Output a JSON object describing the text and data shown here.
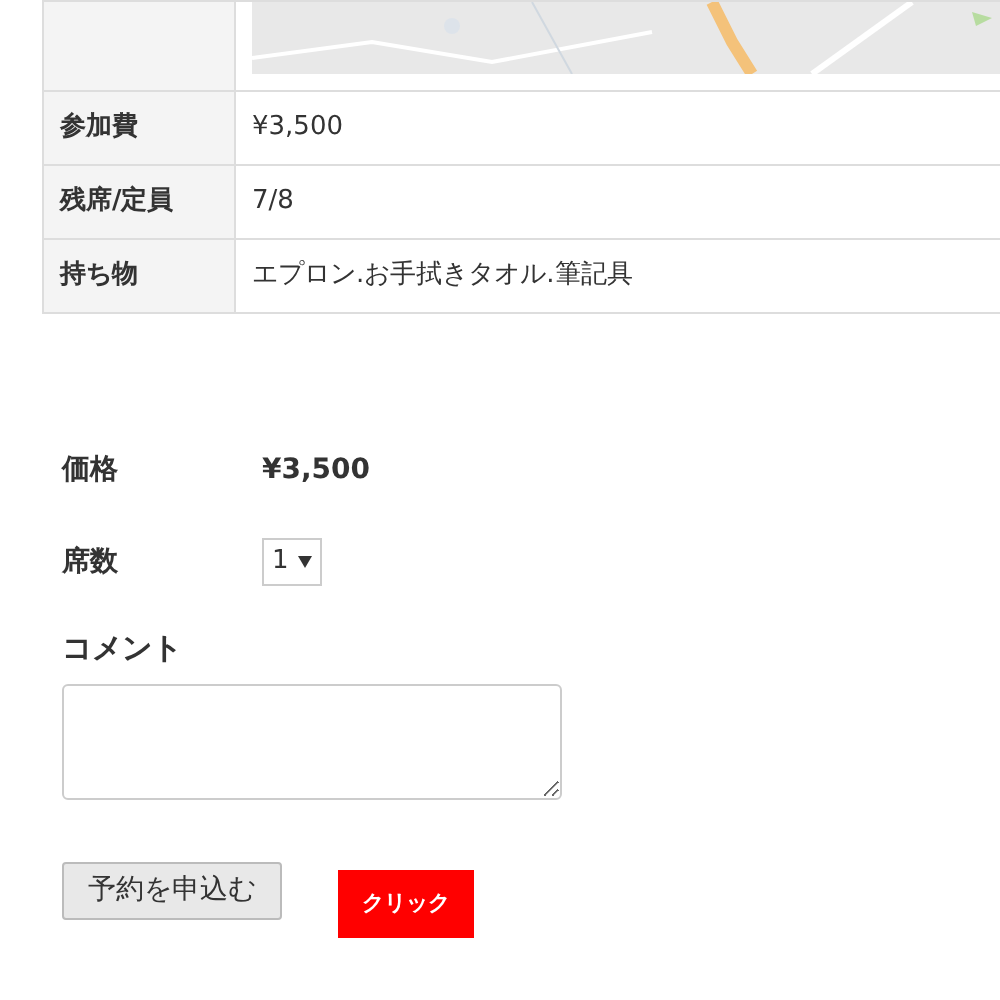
{
  "info_table": {
    "rows": [
      {
        "label": "参加費",
        "value": "¥3,500"
      },
      {
        "label": "残席/定員",
        "value": "7/8"
      },
      {
        "label": "持ち物",
        "value": "エプロン.お手拭きタオル.筆記具"
      }
    ]
  },
  "form": {
    "price_label": "価格",
    "price": "¥3,500",
    "seats_label": "席数",
    "seats_value": "1",
    "comment_label": "コメント",
    "submit": "予約を申込む",
    "callout": "クリック"
  }
}
